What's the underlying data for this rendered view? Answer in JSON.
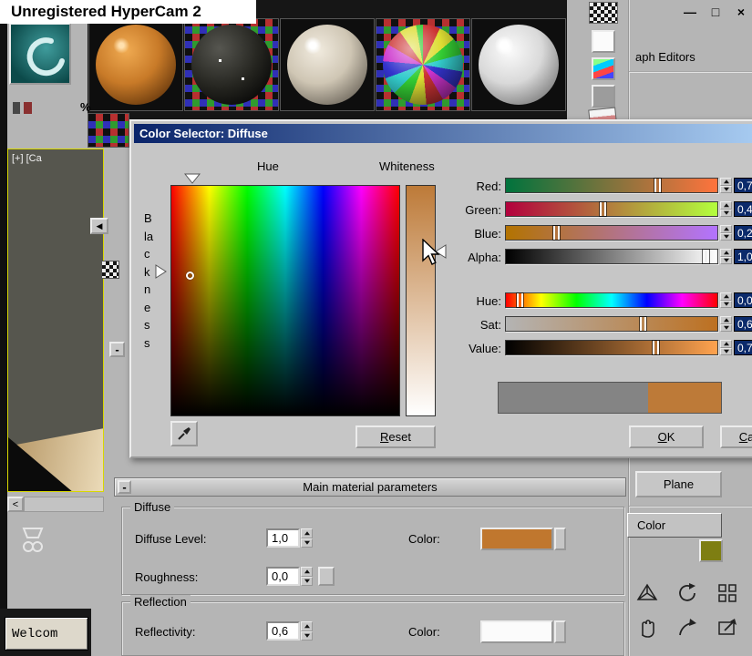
{
  "watermark": {
    "text": "Unregistered HyperCam 2"
  },
  "titlebar": {
    "minimize": "—",
    "maximize": "□",
    "close": "×"
  },
  "menu": {
    "partial_text": "aph Editors"
  },
  "theme": {
    "titlebar_start": "#0a246a",
    "titlebar_end": "#a6caf0",
    "selection": "#0b2a6b",
    "panel": "#b5b5b5"
  },
  "color_selector": {
    "title": "Color Selector: Diffuse",
    "hue_label": "Hue",
    "whiteness_label": "Whiteness",
    "blackness_label": "Blackness",
    "sliders": [
      {
        "label": "Red:",
        "value": "0,7",
        "pos": 72
      },
      {
        "label": "Green:",
        "value": "0,4",
        "pos": 46
      },
      {
        "label": "Blue:",
        "value": "0,2",
        "pos": 24
      },
      {
        "label": "Alpha:",
        "value": "1,0",
        "pos": 95
      },
      {
        "label": "Hue:",
        "value": "0,0",
        "pos": 7
      },
      {
        "label": "Sat:",
        "value": "0,6",
        "pos": 65
      },
      {
        "label": "Value:",
        "value": "0,7",
        "pos": 71
      }
    ],
    "buttons": {
      "reset": "Reset",
      "ok": "OK",
      "cancel": "Cancel"
    },
    "preview": {
      "old_color": "#848484",
      "new_color": "#bd7a38"
    }
  },
  "rollout": {
    "collapse_glyph": "-",
    "title": "Main material parameters",
    "diffuse_group": {
      "title": "Diffuse",
      "diffuse_level_label": "Diffuse Level:",
      "diffuse_level_value": "1,0",
      "color_label": "Color:",
      "color_swatch": "#c0772e",
      "roughness_label": "Roughness:",
      "roughness_value": "0,0"
    },
    "reflection_group": {
      "title": "Reflection",
      "reflectivity_label": "Reflectivity:",
      "reflectivity_value": "0,6",
      "color_label": "Color:",
      "color_swatch": "#fbfbfb"
    }
  },
  "right_panel": {
    "plane_button": "Plane",
    "color_field": "Color",
    "swatch": "#7e7e12"
  },
  "viewport": {
    "label": "[+] [Ca"
  },
  "welcome": {
    "text": "Welcom"
  },
  "nav": {
    "left_scroll": "<",
    "prev_arrow": "◀"
  },
  "misc": {
    "percent_glyph": "%"
  }
}
